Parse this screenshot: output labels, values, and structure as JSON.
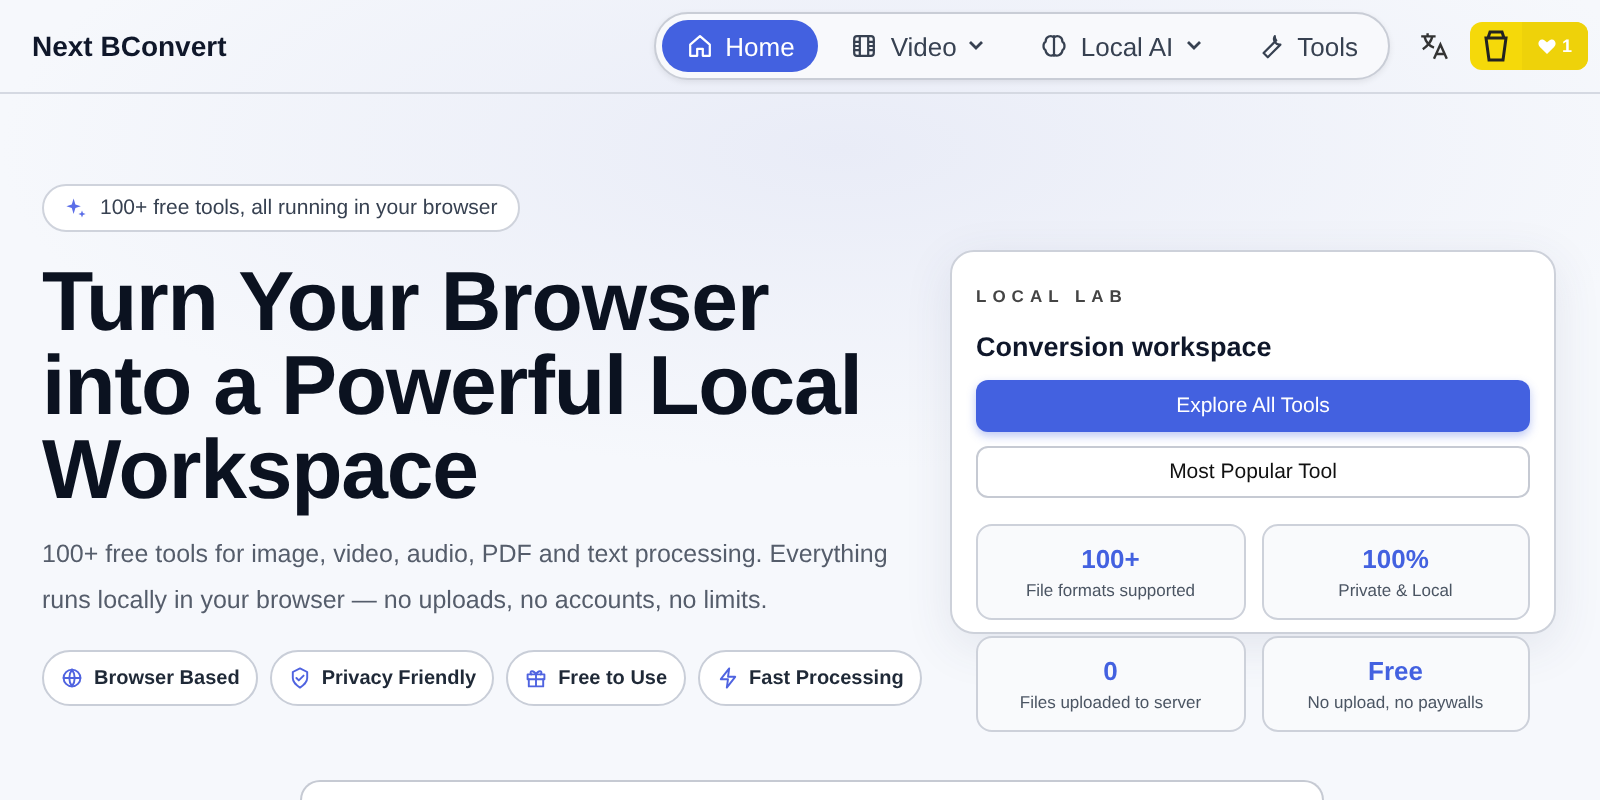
{
  "brand": "Next BConvert",
  "nav": [
    {
      "label": "Home",
      "selected": true,
      "dropdown": false
    },
    {
      "label": "Video",
      "selected": false,
      "dropdown": true
    },
    {
      "label": "Local AI",
      "selected": false,
      "dropdown": true
    },
    {
      "label": "Tools",
      "selected": false,
      "dropdown": false
    }
  ],
  "support": {
    "count": "1"
  },
  "hero": {
    "badge": "100+ free tools, all running in your browser",
    "title": "Turn Your Browser into a Powerful Local Workspace",
    "description": "100+ free tools for image, video, audio, PDF and text processing. Everything runs locally in your browser — no uploads, no accounts, no limits.",
    "features": [
      {
        "label": "Browser Based"
      },
      {
        "label": "Privacy Friendly"
      },
      {
        "label": "Free to Use"
      },
      {
        "label": "Fast Processing"
      }
    ]
  },
  "lab": {
    "eyebrow": "LOCAL LAB",
    "title": "Conversion workspace",
    "primary_button": "Explore All Tools",
    "secondary_button": "Most Popular Tool",
    "stats": [
      {
        "value": "100+",
        "label": "File formats supported"
      },
      {
        "value": "100%",
        "label": "Private & Local"
      },
      {
        "value": "0",
        "label": "Files uploaded to server"
      },
      {
        "value": "Free",
        "label": "No upload, no paywalls"
      }
    ]
  }
}
